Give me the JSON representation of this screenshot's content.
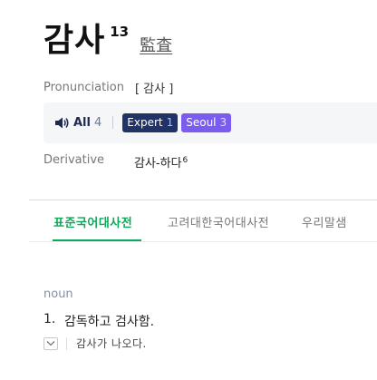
{
  "entry": {
    "headword": "감사",
    "homonym_number": "13",
    "hanja": "監査"
  },
  "pronunciation": {
    "label": "Pronunciation",
    "value": "[ 감사 ]"
  },
  "audio": {
    "all_label": "All",
    "all_count": "4",
    "badges": [
      {
        "label": "Expert",
        "count": "1",
        "color": "#1f3366"
      },
      {
        "label": "Seoul",
        "count": "3",
        "color": "#7a5cf0"
      }
    ],
    "icon": "speaker-icon"
  },
  "derivative": {
    "label": "Derivative",
    "value": "감사-하다",
    "sup": "6"
  },
  "tabs": [
    {
      "label": "표준국어대사전",
      "active": true
    },
    {
      "label": "고려대한국어대사전",
      "active": false
    },
    {
      "label": "우리말샘",
      "active": false
    }
  ],
  "definitions": {
    "part_of_speech": "noun",
    "senses": [
      {
        "number": "1.",
        "text": "감독하고 검사함.",
        "example": "감사가 나오다."
      }
    ]
  },
  "colors": {
    "accent_green": "#0fa85a",
    "navy": "#1b2a4e"
  }
}
